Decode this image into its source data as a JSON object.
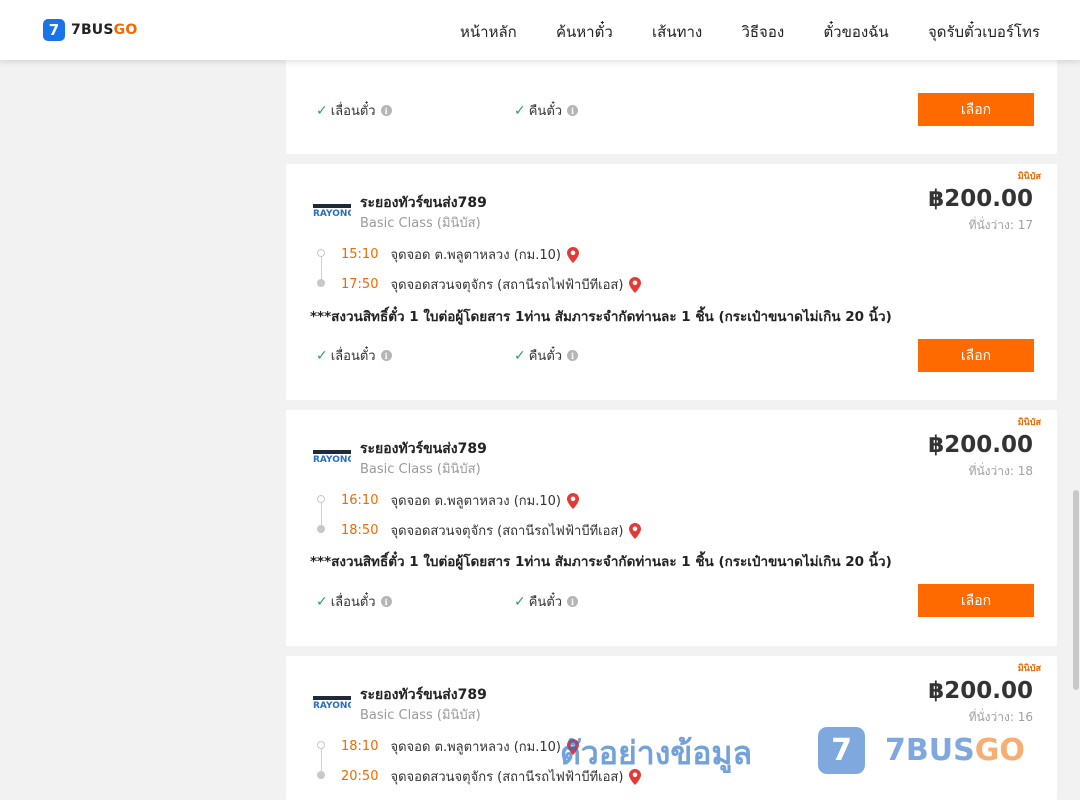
{
  "header": {
    "logo_badge": "7",
    "logo_a": "7BUS",
    "logo_b": "GO",
    "nav": [
      "หน้าหลัก",
      "ค้นหาตั๋ว",
      "เส้นทาง",
      "วิธีจอง",
      "ตั๋วของฉัน",
      "จุดรับตั๋วเบอร์โทร"
    ]
  },
  "cards": [
    {
      "features": [
        "เลื่อนตั๋ว",
        "คืนตั๋ว"
      ],
      "select_label": "เลือก"
    },
    {
      "tag": "มินิบัส",
      "operator": "ระยองทัวร์ขนส่ง789",
      "class": "Basic Class (มินิบัส)",
      "price": "฿200.00",
      "seats": "ที่นั่งว่าง: 17",
      "depart_time": "15:10",
      "depart_place": "จุดจอด ต.พลูตาหลวง (กม.10)",
      "arrive_time": "17:50",
      "arrive_place": "จุดจอดสวนจตุจักร (สถานีรถไฟฟ้าบีทีเอส)",
      "notice": "***สงวนสิทธิ์ตั๋ว 1 ใบต่อผู้โดยสาร 1ท่าน สัมภาระจำกัดท่านละ 1 ชิ้น (กระเป๋าขนาดไม่เกิน 20 นิ้ว)",
      "features": [
        "เลื่อนตั๋ว",
        "คืนตั๋ว"
      ],
      "select_label": "เลือก"
    },
    {
      "tag": "มินิบัส",
      "operator": "ระยองทัวร์ขนส่ง789",
      "class": "Basic Class (มินิบัส)",
      "price": "฿200.00",
      "seats": "ที่นั่งว่าง: 18",
      "depart_time": "16:10",
      "depart_place": "จุดจอด ต.พลูตาหลวง (กม.10)",
      "arrive_time": "18:50",
      "arrive_place": "จุดจอดสวนจตุจักร (สถานีรถไฟฟ้าบีทีเอส)",
      "notice": "***สงวนสิทธิ์ตั๋ว 1 ใบต่อผู้โดยสาร 1ท่าน สัมภาระจำกัดท่านละ 1 ชิ้น (กระเป๋าขนาดไม่เกิน 20 นิ้ว)",
      "features": [
        "เลื่อนตั๋ว",
        "คืนตั๋ว"
      ],
      "select_label": "เลือก"
    },
    {
      "tag": "มินิบัส",
      "operator": "ระยองทัวร์ขนส่ง789",
      "class": "Basic Class (มินิบัส)",
      "price": "฿200.00",
      "seats": "ที่นั่งว่าง: 16",
      "depart_time": "18:10",
      "depart_place": "จุดจอด ต.พลูตาหลวง (กม.10)",
      "arrive_time": "20:50",
      "arrive_place": "จุดจอดสวนจตุจักร (สถานีรถไฟฟ้าบีทีเอส)"
    }
  ],
  "watermark": {
    "text": "ตัวอย่างข้อมูล",
    "badge": "7",
    "brand_a": "7BUS",
    "brand_b": "GO"
  },
  "icons": {
    "check": "check-icon",
    "info": "info-icon",
    "pin": "map-pin-icon",
    "operator_logo": "rayong-logo"
  },
  "colors": {
    "accent": "#ff6a00",
    "time": "#f26a00",
    "check": "#2ea44f",
    "pin": "#e53935"
  }
}
